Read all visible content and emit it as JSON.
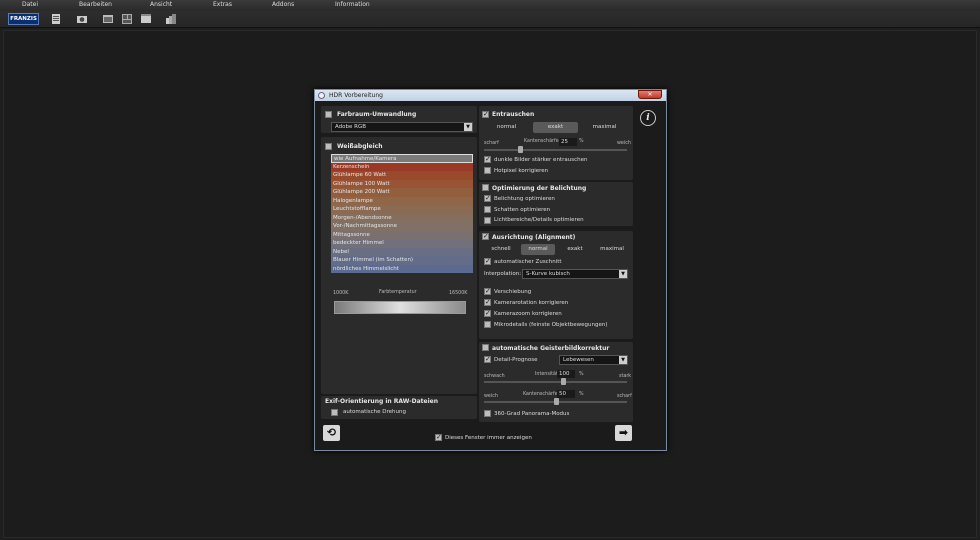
{
  "menu": [
    "Datei",
    "Bearbeiten",
    "Ansicht",
    "Extras",
    "Addons",
    "Information"
  ],
  "toolbar": {
    "logo": "FRANZIS",
    "icons": [
      "file-icon",
      "camera-icon",
      "image-folder-icon",
      "gallery-icon",
      "film-icon",
      "stack-icon"
    ]
  },
  "dialog": {
    "title": "HDR Vorbereitung",
    "close": "✕",
    "info": "i",
    "farbraum": {
      "title": "Farbraum-Umwandlung",
      "checked": false,
      "value": "Adobe RGB"
    },
    "weissabgleich": {
      "title": "Weißabgleich",
      "checked": false,
      "items": [
        {
          "label": "wie Aufnahme/Kamera",
          "color": "#7a7a7a"
        },
        {
          "label": "Kerzenschein",
          "color": "#9a3a26"
        },
        {
          "label": "Glühlampe 60 Watt",
          "color": "#9a4a2c"
        },
        {
          "label": "Glühlampe 100 Watt",
          "color": "#985434"
        },
        {
          "label": "Glühlampe 200 Watt",
          "color": "#935e3e"
        },
        {
          "label": "Halogenlampe",
          "color": "#8f6648"
        },
        {
          "label": "Leuchtstofflampe",
          "color": "#8a6a52"
        },
        {
          "label": "Morgen-/Abendsonne",
          "color": "#866e5c"
        },
        {
          "label": "Vor-/Nachmittagssonne",
          "color": "#807066"
        },
        {
          "label": "Mittagssonne",
          "color": "#7a7070"
        },
        {
          "label": "bedeckter Himmel",
          "color": "#72707a"
        },
        {
          "label": "Nebel",
          "color": "#6a6e82"
        },
        {
          "label": "Blauer Himmel (im Schatten)",
          "color": "#636c88"
        },
        {
          "label": "nördliches Himmelslicht",
          "color": "#5c6a90"
        }
      ],
      "temp_label": "Farbtemperatur",
      "temp_min": "1000K",
      "temp_max": "16500K"
    },
    "exif": {
      "title": "Exif-Orientierung in RAW-Dateien",
      "option": "automatische Drehung",
      "checked": false
    },
    "entrauschen": {
      "title": "Entrauschen",
      "checked": true,
      "modes": [
        "normal",
        "exakt",
        "maximal"
      ],
      "active": 1,
      "left": "scharf",
      "right": "weich",
      "param": "Kantenschärfe",
      "value": "25",
      "unit": "%",
      "value_frac": 0.25,
      "options": [
        {
          "label": "dunkle Bilder stärker entrauschen",
          "checked": true
        },
        {
          "label": "Hotpixel korrigieren",
          "checked": false
        }
      ]
    },
    "belichtung": {
      "title": "Optimierung der Belichtung",
      "checked": false,
      "options": [
        {
          "label": "Belichtung optimieren",
          "checked": true
        },
        {
          "label": "Schatten optimieren",
          "checked": false
        },
        {
          "label": "Lichtbereiche/Details optimieren",
          "checked": false
        }
      ]
    },
    "ausrichtung": {
      "title": "Ausrichtung (Alignment)",
      "checked": true,
      "modes": [
        "schnell",
        "normal",
        "exakt",
        "maximal"
      ],
      "active": 1,
      "zuschnitt": "automatischer Zuschnitt",
      "zuschnitt_checked": true,
      "interp_label": "Interpolation:",
      "interp_value": "S-Kurve kubisch",
      "options": [
        {
          "label": "Verschiebung",
          "checked": true
        },
        {
          "label": "Kamerarotation korrigieren",
          "checked": true
        },
        {
          "label": "Kamerazoom korrigieren",
          "checked": true
        },
        {
          "label": "Mikrodetails (feinste Objektbewegungen)",
          "checked": false
        }
      ]
    },
    "geisterbild": {
      "title": "automatische Geisterbildkorrektur",
      "checked": false,
      "prognose_label": "Detail-Prognose",
      "prognose_checked": true,
      "prognose_value": "Lebewesen",
      "s1_left": "schwach",
      "s1_right": "stark",
      "s1_param": "Intensität",
      "s1_value": "100",
      "s1_unit": "%",
      "s1_frac": 0.55,
      "s2_left": "weich",
      "s2_right": "scharf",
      "s2_param": "Kantenschärfe",
      "s2_value": "50",
      "s2_unit": "%",
      "s2_frac": 0.5,
      "panorama": "360-Grad Panorama-Modus",
      "panorama_checked": false
    },
    "footer": {
      "show_again": "Dieses Fenster immer anzeigen",
      "checked": true,
      "back": "⟲",
      "next": "➡"
    }
  }
}
